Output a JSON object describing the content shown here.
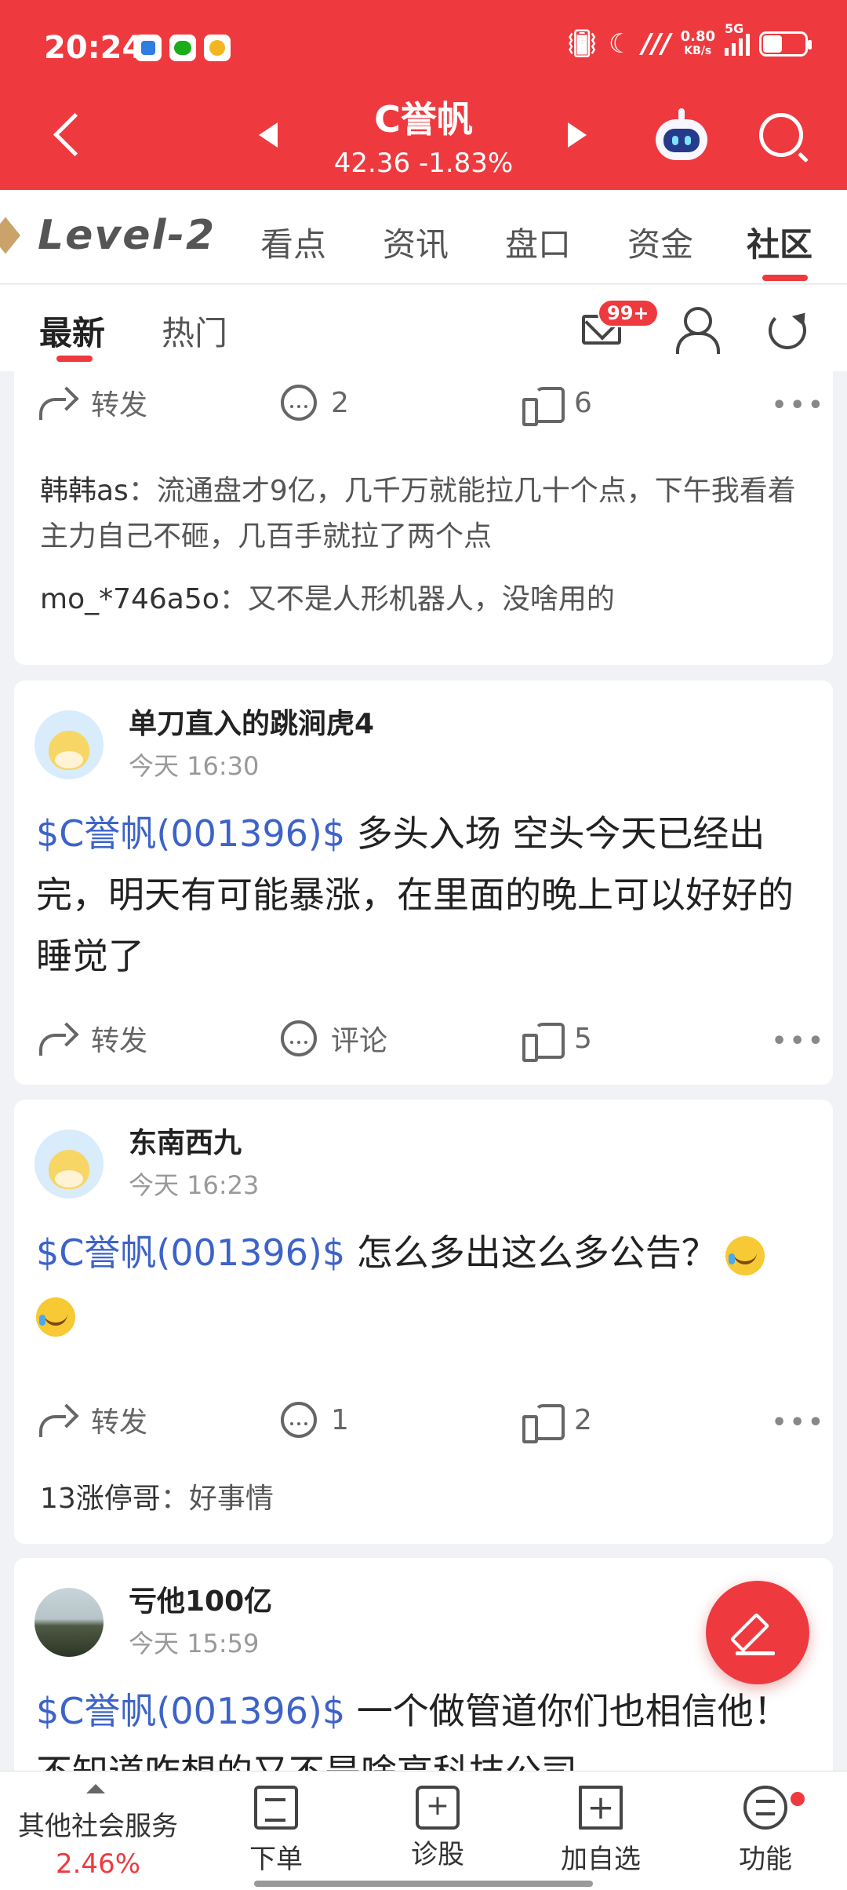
{
  "status_bar": {
    "time": "20:24",
    "net_speed": "0.80",
    "net_unit": "KB/s",
    "network": "5G"
  },
  "header": {
    "stock_name": "C誉帆",
    "price": "42.36",
    "change": "-1.83%",
    "quote": "42.36 -1.83%"
  },
  "tabs": {
    "level2": "Level-2",
    "items": [
      "看点",
      "资讯",
      "盘口",
      "资金",
      "社区"
    ],
    "active": "社区"
  },
  "subtabs": {
    "latest": "最新",
    "hot": "热门",
    "mail_badge": "99+"
  },
  "posts": [
    {
      "actions": {
        "share": "转发",
        "comments": "2",
        "likes": "6"
      },
      "replies": [
        {
          "user": "韩韩as",
          "text": "流通盘才9亿，几千万就能拉几十个点，下午我看着主力自己不砸，几百手就拉了两个点"
        },
        {
          "user": "mo_*746a5o",
          "text": "又不是人形机器人，没啥用的"
        }
      ]
    },
    {
      "author": "单刀直入的跳涧虎4",
      "time": "今天 16:30",
      "stock_tag": "$C誉帆(001396)$",
      "text": " 多头入场 空头今天已经出完，明天有可能暴涨，在里面的晚上可以好好的睡觉了",
      "actions": {
        "share": "转发",
        "comments": "评论",
        "likes": "5"
      }
    },
    {
      "author": "东南西九",
      "time": "今天 16:23",
      "stock_tag": "$C誉帆(001396)$",
      "text": " 怎么多出这么多公告？",
      "actions": {
        "share": "转发",
        "comments": "1",
        "likes": "2"
      },
      "replies": [
        {
          "user": "13涨停哥",
          "text": "好事情"
        }
      ]
    },
    {
      "author": "亏他100亿",
      "time": "今天 15:59",
      "stock_tag": "$C誉帆(001396)$",
      "text": " 一个做管道你们也相信他！不知道咋想的又不是啥高科技公司"
    }
  ],
  "bottom_nav": {
    "other": "其他社会服务",
    "other_pct": "2.46%",
    "items": [
      "下单",
      "诊股",
      "加自选",
      "功能"
    ]
  }
}
